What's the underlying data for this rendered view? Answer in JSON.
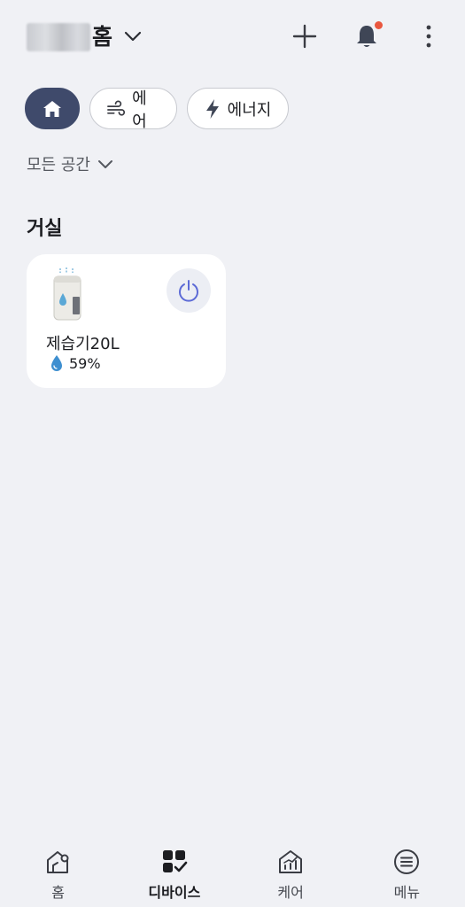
{
  "header": {
    "title": "홈",
    "icons": [
      "chevron-down-icon",
      "plus-icon",
      "bell-icon",
      "more-vertical-icon"
    ],
    "notification_dot_color": "#e9573f"
  },
  "filters": {
    "items": [
      {
        "label": "",
        "icon": "home-icon",
        "active": true
      },
      {
        "label": "에어",
        "icon": "wind-icon",
        "active": false
      },
      {
        "label": "에너지",
        "icon": "lightning-icon",
        "active": false
      }
    ],
    "active_color": "#3f4a6b"
  },
  "space_selector": {
    "label": "모든 공간"
  },
  "room": {
    "title": "거실"
  },
  "devices": [
    {
      "name": "제습기20L",
      "stat": "59%",
      "stat_icon": "water-drop-icon",
      "power_icon": "power-icon",
      "power_color": "#5c6ad6"
    }
  ],
  "bottom_nav": {
    "items": [
      {
        "label": "홈",
        "icon": "home-outline-icon",
        "active": false
      },
      {
        "label": "디바이스",
        "icon": "devices-icon",
        "active": true
      },
      {
        "label": "케어",
        "icon": "care-chart-icon",
        "active": false
      },
      {
        "label": "메뉴",
        "icon": "menu-icon",
        "active": false
      }
    ]
  }
}
